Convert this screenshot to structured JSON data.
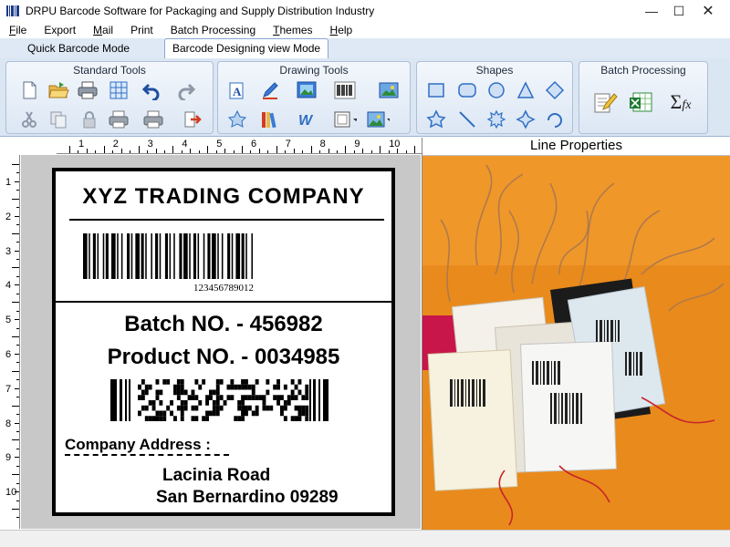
{
  "window": {
    "title": "DRPU Barcode Software for Packaging and Supply Distribution Industry",
    "minimize_glyph": "—",
    "maximize_glyph": "☐",
    "close_glyph": "✕"
  },
  "menu": {
    "items": [
      {
        "ul": "F",
        "rest": "ile"
      },
      {
        "ul": "",
        "rest": "Export"
      },
      {
        "ul": "M",
        "rest": "ail"
      },
      {
        "ul": "",
        "rest": "Print"
      },
      {
        "ul": "",
        "rest": "Batch Processing"
      },
      {
        "ul": "T",
        "rest": "hemes"
      },
      {
        "ul": "H",
        "rest": "elp"
      }
    ]
  },
  "modes": {
    "quick": "Quick Barcode Mode",
    "design": "Barcode Designing view Mode"
  },
  "ribbon": {
    "standard_tools": "Standard Tools",
    "drawing_tools": "Drawing Tools",
    "shapes": "Shapes",
    "batch_processing": "Batch Processing",
    "sigma_label": "Σ",
    "fx_label": "fx",
    "w_label": "W"
  },
  "rulers": {
    "top": [
      "1",
      "2",
      "3",
      "4",
      "5",
      "6",
      "7",
      "8",
      "9",
      "10"
    ],
    "left": [
      "1",
      "2",
      "3",
      "4",
      "5",
      "6",
      "7",
      "8",
      "9",
      "10"
    ]
  },
  "label": {
    "company": "XYZ TRADING COMPANY",
    "barcode_text": "123456789012",
    "batch": "Batch NO.  - 456982",
    "product": "Product NO.  - 0034985",
    "address_label": "Company Address :",
    "address_line1": "Lacinia Road",
    "address_line2": "San Bernardino 09289"
  },
  "panel": {
    "title": "Line Properties"
  },
  "colors": {
    "ribbon_bg": "#dbe6f3",
    "accent_blue": "#2f6fc3",
    "photo_bg": "#e98a1c"
  }
}
